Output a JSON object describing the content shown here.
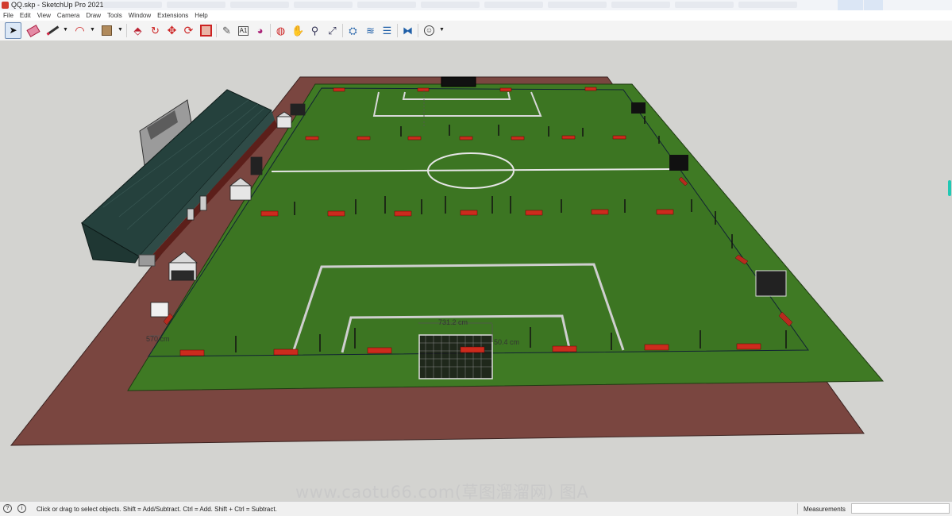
{
  "window": {
    "title": "QQ.skp - SketchUp Pro 2021"
  },
  "menu": [
    "File",
    "Edit",
    "View",
    "Camera",
    "Draw",
    "Tools",
    "Window",
    "Extensions",
    "Help"
  ],
  "toolbar": {
    "tools": [
      {
        "name": "select-tool",
        "icon": "arrow-cursor-icon",
        "active": true
      },
      {
        "name": "eraser-tool",
        "icon": "eraser-icon"
      },
      {
        "name": "line-tool",
        "icon": "pencil-icon"
      },
      {
        "name": "arc-tool",
        "icon": "arc-icon"
      },
      {
        "name": "rectangle-tool",
        "icon": "rectangle-icon"
      },
      {
        "name": "push-pull-tool",
        "icon": "push-pull-icon"
      },
      {
        "name": "offset-tool",
        "icon": "offset-icon"
      },
      {
        "name": "move-tool",
        "icon": "move-icon"
      },
      {
        "name": "rotate-tool",
        "icon": "rotate-icon"
      },
      {
        "name": "scale-tool",
        "icon": "scale-icon"
      },
      {
        "name": "tape-measure-tool",
        "icon": "tape-measure-icon"
      },
      {
        "name": "text-tool",
        "icon": "text-icon"
      },
      {
        "name": "paint-bucket-tool",
        "icon": "paint-bucket-icon"
      },
      {
        "name": "orbit-tool",
        "icon": "orbit-icon"
      },
      {
        "name": "pan-tool",
        "icon": "pan-icon"
      },
      {
        "name": "zoom-tool",
        "icon": "zoom-icon"
      },
      {
        "name": "zoom-extents-tool",
        "icon": "zoom-extents-icon"
      },
      {
        "name": "3d-warehouse-button",
        "icon": "warehouse-icon"
      },
      {
        "name": "extension-warehouse-button",
        "icon": "extension-warehouse-icon"
      },
      {
        "name": "layout-button",
        "icon": "layout-icon"
      },
      {
        "name": "extension-manager-button",
        "icon": "extension-manager-icon"
      },
      {
        "name": "account-button",
        "icon": "user-icon"
      }
    ]
  },
  "viewport": {
    "dimension_labels": [
      "731.2 cm",
      "50.4 cm",
      "570 cm"
    ],
    "colors": {
      "background": "#d3d3d0",
      "track": "#7a4640",
      "grass": "#3f7a24",
      "grass_dark": "#386e20",
      "roof": "#25413d",
      "banner": "#cc2b1d"
    }
  },
  "watermark": "www.caotu66.com(草图溜溜网) 图A",
  "status": {
    "message": "Click or drag to select objects. Shift = Add/Subtract. Ctrl = Add. Shift + Ctrl = Subtract.",
    "measurements_label": "Measurements",
    "measurements_value": ""
  }
}
